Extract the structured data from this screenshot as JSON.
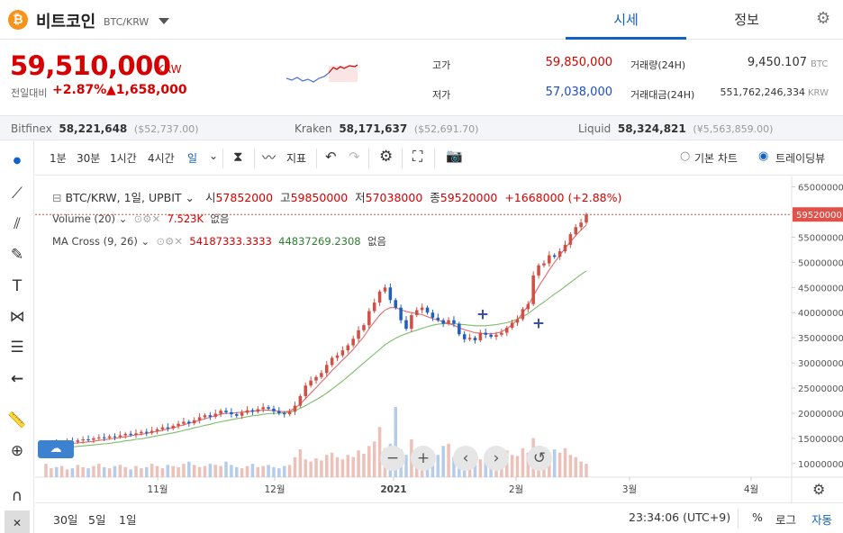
{
  "header": {
    "coin_icon": "bitcoin-icon",
    "coin_name": "비트코인",
    "pair": "BTC/KRW",
    "tabs": [
      "시세",
      "정보"
    ],
    "gear_icon": "gear-icon"
  },
  "quote": {
    "price": "59,510,000",
    "unit": "KRW",
    "compare_label": "전일대비",
    "change_pct": "+2.87%",
    "change_amount": "▲1,658,000",
    "high_label": "고가",
    "high_value": "59,850,000",
    "low_label": "저가",
    "low_value": "57,038,000",
    "volume_label": "거래량(24H)",
    "volume_value": "9,450.107",
    "volume_unit": "BTC",
    "amount_label": "거래대금(24H)",
    "amount_value": "551,762,246,334",
    "amount_unit": "KRW"
  },
  "exchanges": [
    {
      "name": "Bitfinex",
      "value": "58,221,648",
      "usd": "($52,737.00)"
    },
    {
      "name": "Kraken",
      "value": "58,171,637",
      "usd": "($52,691.70)"
    },
    {
      "name": "Liquid",
      "value": "58,324,821",
      "usd": "(¥5,563,859.00)"
    }
  ],
  "toolbar": {
    "intervals": [
      "1분",
      "30분",
      "1시간",
      "4시간",
      "일"
    ],
    "indicator_label": "지표",
    "basic_chart": "기본 차트",
    "tradingview": "트레이딩뷰"
  },
  "legend": {
    "symbol": "BTC/KRW, 1일, UPBIT",
    "open_label": "시",
    "open": "57852000",
    "high_label": "고",
    "high": "59850000",
    "low_label": "저",
    "low": "57038000",
    "close_label": "종",
    "close": "59520000",
    "change": "+1668000 (+2.88%)",
    "volume_name": "Volume (20)",
    "volume_value": "7.523K",
    "none_label": "없음",
    "ma_name": "MA Cross (9, 26)",
    "ma_fast": "54187333.3333",
    "ma_slow": "44837269.2308"
  },
  "chart_data": {
    "type": "candlestick",
    "y_ticks": [
      "65000000",
      "60000000",
      "55000000",
      "50000000",
      "45000000",
      "40000000",
      "35000000",
      "30000000",
      "25000000",
      "20000000",
      "15000000",
      "10000000"
    ],
    "x_ticks": [
      "11월",
      "12월",
      "2021",
      "2월",
      "3월",
      "4월"
    ],
    "last_price_label": "59520000",
    "ylim": [
      8000000,
      66000000
    ],
    "closes": [
      13.9,
      14.0,
      13.8,
      14.2,
      14.4,
      14.3,
      14.6,
      14.8,
      14.7,
      15.0,
      15.2,
      15.1,
      15.4,
      15.3,
      15.6,
      15.9,
      15.7,
      16.0,
      16.3,
      16.1,
      16.5,
      16.8,
      17.2,
      17.0,
      17.5,
      17.9,
      18.3,
      18.0,
      18.6,
      19.2,
      19.6,
      19.3,
      19.9,
      20.5,
      20.2,
      19.8,
      19.5,
      20.1,
      20.6,
      20.3,
      20.8,
      21.2,
      20.9,
      20.4,
      20.0,
      19.8,
      20.3,
      21.5,
      23.4,
      25.5,
      26.5,
      27.2,
      28.0,
      29.6,
      31.0,
      31.5,
      32.5,
      33.5,
      34.8,
      36.5,
      37.5,
      40.3,
      42.0,
      44.2,
      45.0,
      42.5,
      41.0,
      38.5,
      36.8,
      39.5,
      40.5,
      41.0,
      40.0,
      39.0,
      38.5,
      37.8,
      38.5,
      37.8,
      35.7,
      34.7,
      35.0,
      34.5,
      36.0,
      35.6,
      35.2,
      35.6,
      36.0,
      37.0,
      38.0,
      38.7,
      40.7,
      41.7,
      47.4,
      49.4,
      49.8,
      51.4,
      51.1,
      52.2,
      53.5,
      55.6,
      57.0,
      57.9,
      59.5
    ],
    "volumes": [
      1.2,
      0.8,
      0.9,
      1.0,
      0.7,
      0.8,
      1.1,
      0.9,
      0.8,
      1.0,
      1.2,
      0.9,
      0.8,
      1.0,
      1.1,
      0.9,
      0.7,
      1.0,
      0.8,
      0.9,
      1.2,
      1.0,
      0.8,
      1.1,
      1.0,
      0.9,
      1.2,
      1.4,
      1.1,
      0.9,
      1.0,
      1.2,
      1.1,
      1.0,
      1.4,
      1.1,
      0.9,
      0.8,
      1.0,
      1.2,
      0.9,
      1.0,
      1.1,
      0.9,
      0.8,
      1.0,
      1.1,
      1.8,
      2.5,
      1.6,
      1.4,
      1.7,
      1.5,
      2.0,
      2.2,
      1.8,
      1.6,
      2.0,
      1.8,
      2.4,
      2.1,
      2.8,
      3.2,
      4.5,
      2.6,
      3.0,
      6.3,
      2.5,
      2.0,
      3.4,
      2.2,
      2.0,
      2.5,
      1.8,
      2.0,
      2.8,
      3.0,
      1.8,
      2.2,
      2.0,
      1.7,
      1.9,
      1.6,
      1.5,
      2.2,
      1.8,
      1.6,
      2.4,
      2.0,
      1.9,
      2.6,
      2.2,
      3.5,
      2.8,
      2.2,
      2.0,
      2.5,
      2.2,
      2.6,
      2.0,
      1.8,
      1.4,
      1.2
    ],
    "ma9": [
      13.5,
      13.6,
      13.7,
      13.8,
      13.9,
      14.0,
      14.1,
      14.2,
      14.3,
      14.4,
      14.6,
      14.7,
      14.9,
      15.0,
      15.2,
      15.3,
      15.5,
      15.7,
      15.8,
      16.0,
      16.2,
      16.4,
      16.6,
      16.9,
      17.1,
      17.4,
      17.7,
      18.0,
      18.3,
      18.6,
      18.9,
      19.2,
      19.5,
      19.8,
      20.0,
      20.0,
      20.1,
      20.2,
      20.3,
      20.4,
      20.5,
      20.6,
      20.6,
      20.5,
      20.4,
      20.3,
      20.4,
      21.0,
      21.8,
      22.9,
      24.0,
      25.1,
      26.2,
      27.3,
      28.5,
      29.5,
      30.6,
      31.6,
      32.7,
      34.0,
      35.2,
      36.8,
      38.2,
      39.5,
      40.5,
      41.0,
      41.0,
      40.6,
      40.2,
      40.0,
      39.8,
      39.6,
      39.2,
      38.8,
      38.5,
      38.2,
      37.8,
      37.5,
      37.0,
      36.6,
      36.3,
      36.0,
      35.9,
      35.8,
      35.8,
      35.9,
      36.2,
      36.8,
      37.6,
      38.6,
      39.9,
      41.4,
      43.3,
      45.2,
      46.8,
      48.5,
      50.0,
      51.4,
      52.8,
      54.1,
      55.3,
      56.4,
      57.4
    ],
    "ma26": [
      12.8,
      12.9,
      13.0,
      13.1,
      13.2,
      13.3,
      13.4,
      13.5,
      13.6,
      13.7,
      13.8,
      13.9,
      14.0,
      14.2,
      14.3,
      14.5,
      14.6,
      14.8,
      14.9,
      15.1,
      15.3,
      15.5,
      15.7,
      15.9,
      16.1,
      16.3,
      16.6,
      16.8,
      17.1,
      17.3,
      17.6,
      17.8,
      18.1,
      18.3,
      18.5,
      18.7,
      18.9,
      19.1,
      19.3,
      19.5,
      19.6,
      19.8,
      19.9,
      20.0,
      20.0,
      20.1,
      20.2,
      20.5,
      21.0,
      21.5,
      22.1,
      22.7,
      23.3,
      24.0,
      24.8,
      25.6,
      26.4,
      27.3,
      28.2,
      29.1,
      30.0,
      30.9,
      31.8,
      32.7,
      33.6,
      34.3,
      34.9,
      35.4,
      35.8,
      36.2,
      36.5,
      36.9,
      37.2,
      37.5,
      37.7,
      37.8,
      37.8,
      37.8,
      37.7,
      37.6,
      37.5,
      37.4,
      37.4,
      37.4,
      37.5,
      37.6,
      37.8,
      38.0,
      38.3,
      38.7,
      39.2,
      39.8,
      40.6,
      41.4,
      42.1,
      42.9,
      43.7,
      44.4,
      45.2,
      46.0,
      46.8,
      47.6,
      48.3
    ]
  },
  "bottom": {
    "ranges": [
      "30일",
      "5일",
      "1일"
    ],
    "clock": "23:34:06 (UTC+9)",
    "pct": "%",
    "log": "로그",
    "auto": "자동"
  }
}
